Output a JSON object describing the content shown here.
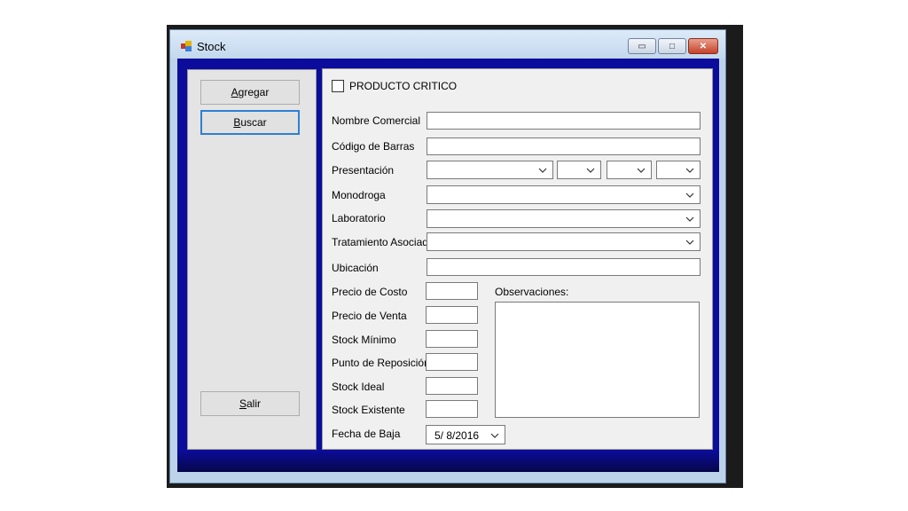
{
  "window": {
    "title": "Stock"
  },
  "caption_buttons": {
    "minimize": "▭",
    "maximize": "□",
    "close": "✕"
  },
  "sidebar": {
    "agregar": {
      "mnemonic": "A",
      "rest": "gregar"
    },
    "buscar": {
      "mnemonic": "B",
      "rest": "uscar"
    },
    "salir": {
      "mnemonic": "S",
      "rest": "alir"
    }
  },
  "form": {
    "producto_critico": {
      "label": "PRODUCTO CRITICO",
      "checked": false
    },
    "nombre_comercial": {
      "label": "Nombre Comercial",
      "value": ""
    },
    "codigo_barras": {
      "label": "Código de Barras",
      "value": ""
    },
    "presentacion": {
      "label": "Presentación",
      "values": [
        "",
        "",
        "",
        ""
      ]
    },
    "monodroga": {
      "label": "Monodroga",
      "value": ""
    },
    "laboratorio": {
      "label": "Laboratorio",
      "value": ""
    },
    "tratamiento": {
      "label": "Tratamiento Asociado",
      "value": ""
    },
    "ubicacion": {
      "label": "Ubicación",
      "value": ""
    },
    "precio_costo": {
      "label": "Precio de Costo",
      "value": ""
    },
    "precio_venta": {
      "label": "Precio de Venta",
      "value": ""
    },
    "stock_minimo": {
      "label": "Stock Mínimo",
      "value": ""
    },
    "punto_reposicion": {
      "label": "Punto de Reposición",
      "value": ""
    },
    "stock_ideal": {
      "label": "Stock Ideal",
      "value": ""
    },
    "stock_existente": {
      "label": "Stock Existente",
      "value": ""
    },
    "observaciones": {
      "label": "Observaciones:",
      "value": ""
    },
    "fecha_baja": {
      "label": "Fecha de Baja",
      "value": "5/  8/2016"
    }
  },
  "icons": {
    "dropdown": "chevron-down-icon",
    "app": "app-icon"
  },
  "colors": {
    "client_bg": "#0c0c9c",
    "focus_border": "#2e7fd3",
    "close_button": "#c4412b"
  }
}
